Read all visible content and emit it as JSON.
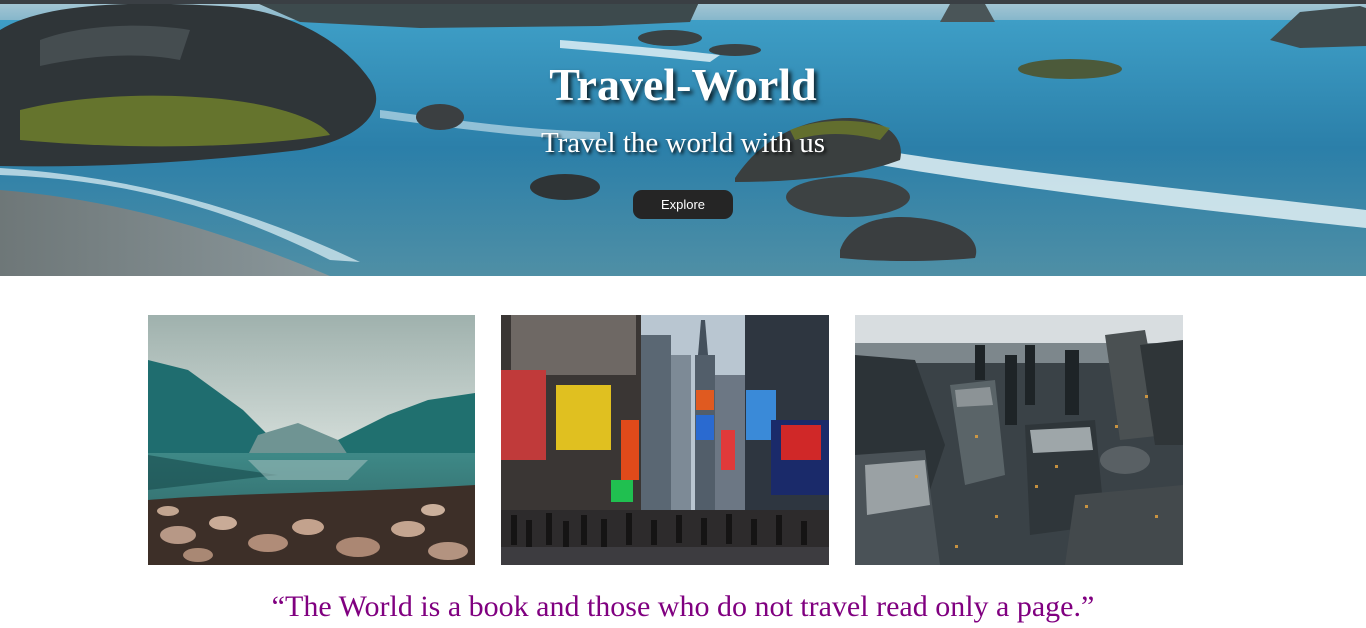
{
  "hero": {
    "title": "Travel-World",
    "subtitle": "Travel the world with us",
    "explore_label": "Explore"
  },
  "gallery": {
    "images": [
      {
        "name": "lake-image",
        "subject": "mountain lake with rocks"
      },
      {
        "name": "city-street-image",
        "subject": "busy city square with billboards"
      },
      {
        "name": "aerial-city-image",
        "subject": "aerial view of skyscrapers"
      }
    ]
  },
  "quote": {
    "text": "“The World is a book and those who do not travel read only a page.”"
  },
  "colors": {
    "quote": "#800080",
    "button": "#252525",
    "hero_text": "#ffffff",
    "sea": "#2a78a0"
  }
}
